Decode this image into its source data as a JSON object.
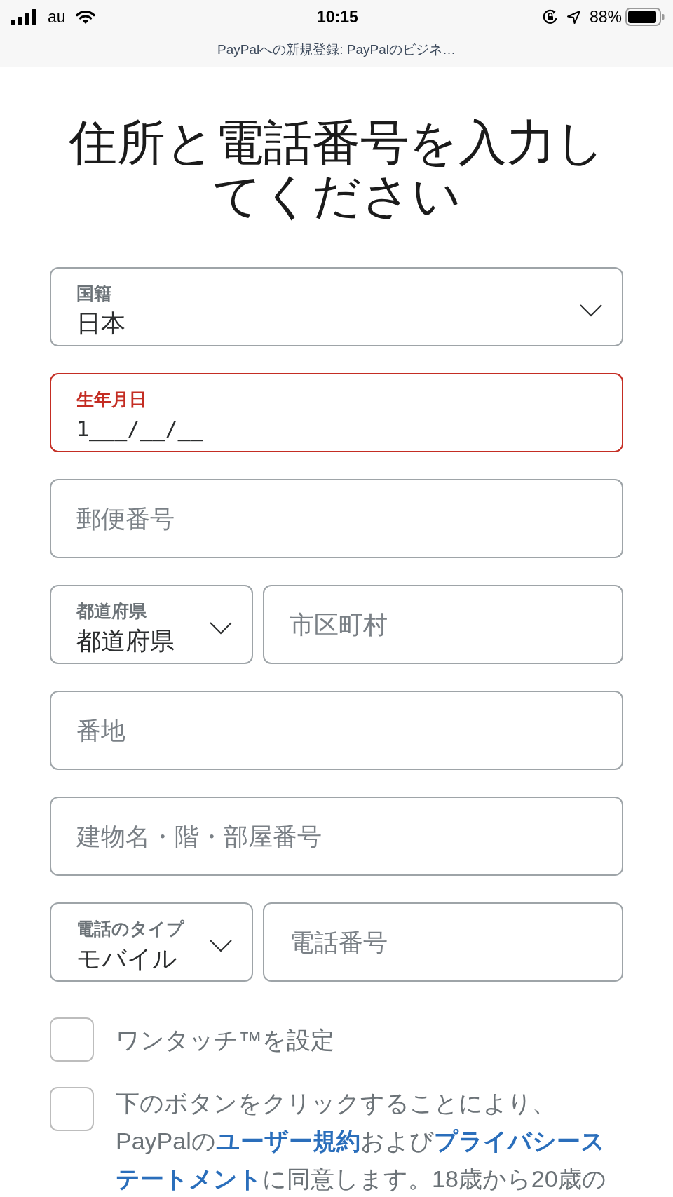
{
  "status_bar": {
    "carrier": "au",
    "time": "10:15",
    "battery": "88%"
  },
  "browser": {
    "title": "PayPalへの新規登録: PayPalのビジネ…"
  },
  "heading": "住所と電話番号を入力してください",
  "form": {
    "rows": [
      {
        "fields": [
          {
            "kind": "select",
            "label": "国籍",
            "value": "日本",
            "error": false
          }
        ]
      },
      {
        "fields": [
          {
            "kind": "text",
            "label": "生年月日",
            "value": "1___/__/__",
            "error": true
          }
        ]
      },
      {
        "fields": [
          {
            "kind": "text",
            "placeholder": "郵便番号",
            "error": false
          }
        ]
      },
      {
        "fields": [
          {
            "kind": "select",
            "label": "都道府県",
            "value": "都道府県",
            "error": false
          },
          {
            "kind": "text",
            "placeholder": "市区町村",
            "error": false
          }
        ]
      },
      {
        "fields": [
          {
            "kind": "text",
            "placeholder": "番地",
            "error": false
          }
        ]
      },
      {
        "fields": [
          {
            "kind": "text",
            "placeholder": "建物名・階・部屋番号",
            "error": false
          }
        ]
      },
      {
        "fields": [
          {
            "kind": "select",
            "label": "電話のタイプ",
            "value": "モバイル",
            "error": false
          },
          {
            "kind": "text",
            "placeholder": "電話番号",
            "error": false
          }
        ]
      }
    ]
  },
  "checkboxes": [
    {
      "checked": false,
      "lines": [
        [
          {
            "kind": "text",
            "text": "ワンタッチ™を設定"
          }
        ]
      ]
    },
    {
      "checked": false,
      "lines": [
        [
          {
            "kind": "text",
            "text": "下のボタンをクリックすることにより、"
          }
        ],
        [
          {
            "kind": "text",
            "text": "PayPalの"
          },
          {
            "kind": "link",
            "text": "ユーザー規約"
          },
          {
            "kind": "text",
            "text": "および"
          },
          {
            "kind": "link",
            "text": "プライバシース"
          }
        ],
        [
          {
            "kind": "link",
            "text": "テートメント"
          },
          {
            "kind": "text",
            "text": "に同意します。18歳から20歳の"
          }
        ]
      ]
    }
  ]
}
